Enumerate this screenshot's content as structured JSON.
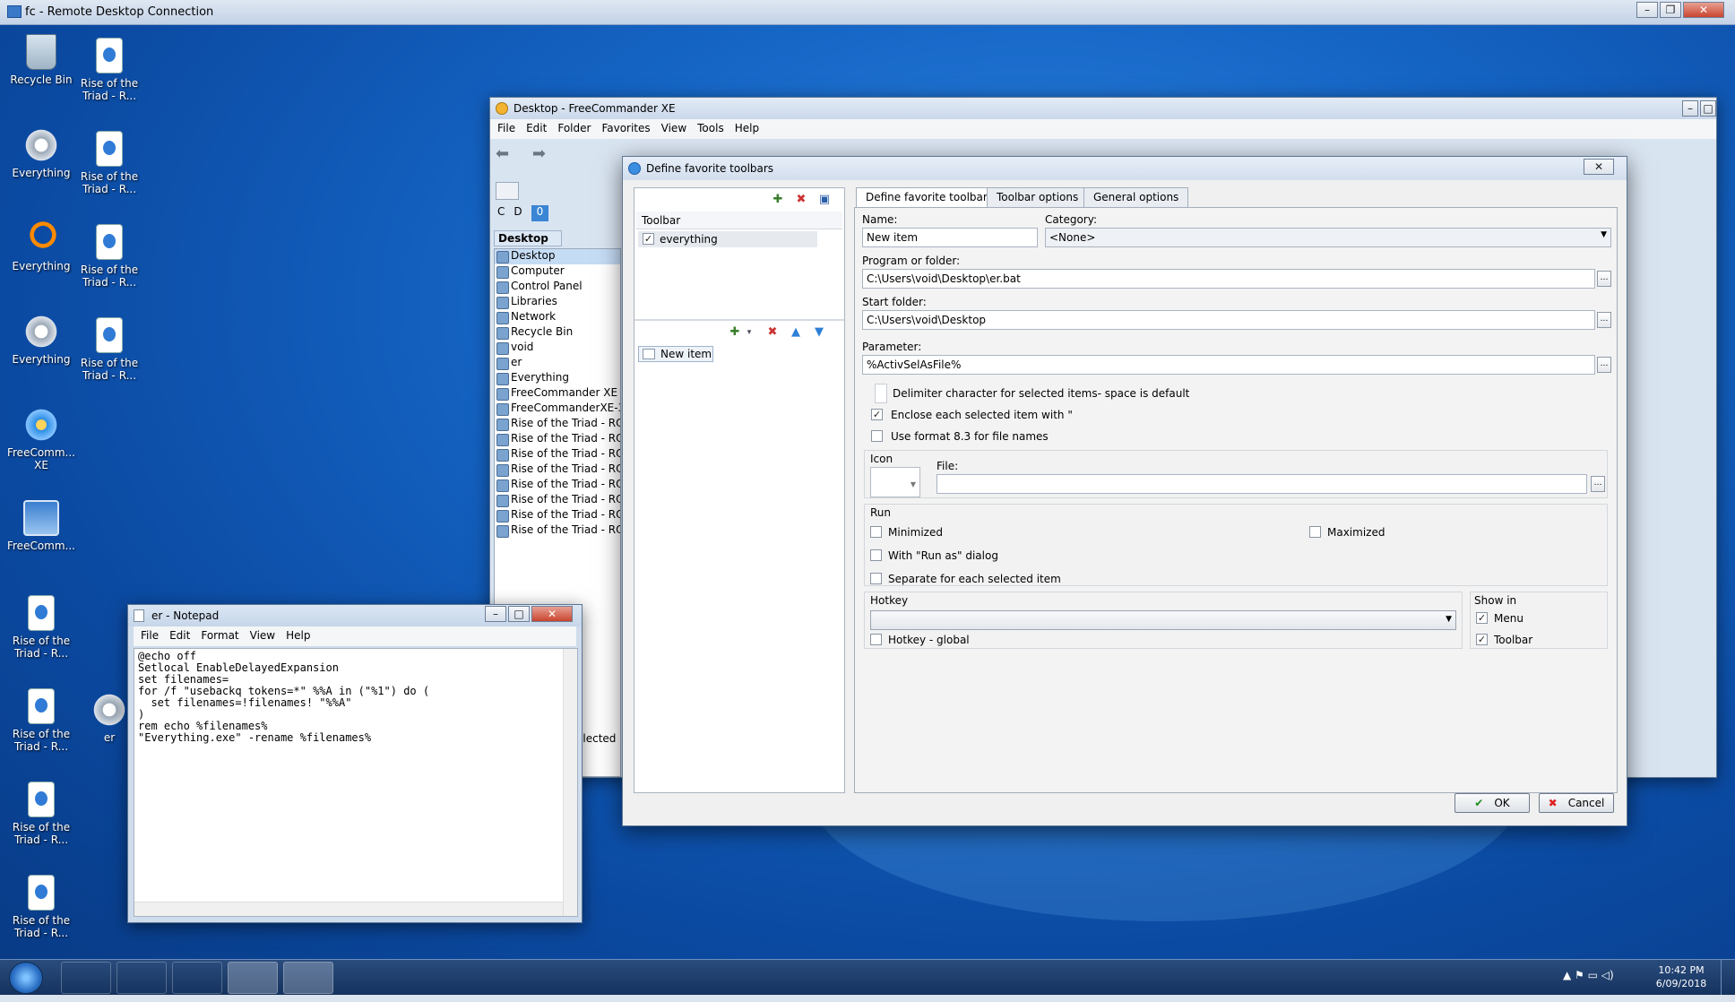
{
  "rdp": {
    "title": "fc - Remote Desktop Connection"
  },
  "desktop_icons": [
    {
      "label": "Recycle Bin"
    },
    {
      "label": "Rise of the Triad - R..."
    },
    {
      "label": "Everything"
    },
    {
      "label": "Rise of the Triad - R..."
    },
    {
      "label": "Everything"
    },
    {
      "label": "Rise of the Triad - R..."
    },
    {
      "label": "Everything"
    },
    {
      "label": "Rise of the Triad - R..."
    },
    {
      "label": "FreeComm... XE"
    },
    {
      "label": "FreeComm..."
    },
    {
      "label": "Rise of the Triad - R..."
    },
    {
      "label": "Rise of the Triad - R..."
    },
    {
      "label": "er"
    },
    {
      "label": "Rise of the Triad - R..."
    },
    {
      "label": "Rise of the Triad - R..."
    }
  ],
  "fc": {
    "title": "Desktop - FreeCommander XE",
    "menu": [
      "File",
      "Edit",
      "Folder",
      "Favorites",
      "View",
      "Tools",
      "Help"
    ],
    "drives": [
      "C",
      "D",
      "0"
    ],
    "tab_label": "Desktop",
    "tree_root": "Desktop",
    "tree": [
      "Computer",
      "Control Panel",
      "Libraries",
      "Network",
      "Recycle Bin",
      "void",
      "er",
      "Everything",
      "FreeCommander XE",
      "FreeCommanderXE-32",
      "Rise of the Triad - RO",
      "Rise of the Triad - RO",
      "Rise of the Triad - RO",
      "Rise of the Triad - RO",
      "Rise of the Triad - RO",
      "Rise of the Triad - RO",
      "Rise of the Triad - RO",
      "Rise of the Triad - RO"
    ],
    "status_fragment": "elected"
  },
  "dialog": {
    "title": "Define favorite toolbars",
    "toolbar_header": "Toolbar",
    "toolbar_item": "everything",
    "item_name": "New item",
    "tabs": [
      "Define favorite toolbars",
      "Toolbar options",
      "General options"
    ],
    "name_label": "Name:",
    "name_value": "New item",
    "category_label": "Category:",
    "category_value": "<None>",
    "program_label": "Program or folder:",
    "program_value": "C:\\Users\\void\\Desktop\\er.bat",
    "start_label": "Start folder:",
    "start_value": "C:\\Users\\void\\Desktop",
    "param_label": "Parameter:",
    "param_value": "%ActivSelAsFile%",
    "delimiter_label": "Delimiter character for selected items- space is default",
    "enclose_label": "Enclose each selected item with \"",
    "format83_label": "Use format 8.3 for file names",
    "icon_label": "Icon",
    "file_label": "File:",
    "run_label": "Run",
    "minimized_label": "Minimized",
    "maximized_label": "Maximized",
    "runas_label": "With \"Run as\" dialog",
    "separate_label": "Separate for each selected item",
    "hotkey_label": "Hotkey",
    "hotkey_global_label": "Hotkey - global",
    "showin_label": "Show in",
    "menu_label": "Menu",
    "toolbar_label": "Toolbar",
    "ok_label": "OK",
    "cancel_label": "Cancel",
    "checks": {
      "enclose": true,
      "menu": true,
      "toolbar": true,
      "everything": true
    }
  },
  "notepad": {
    "title": "er - Notepad",
    "menu": [
      "File",
      "Edit",
      "Format",
      "View",
      "Help"
    ],
    "lines": [
      "@echo off",
      "Setlocal EnableDelayedExpansion",
      "set filenames=",
      "for /f \"usebackq tokens=*\" %%A in (\"%1\") do (",
      "  set filenames=!filenames! \"%%A\"",
      ")",
      "rem echo %filenames%",
      "\"Everything.exe\" -rename %filenames%"
    ]
  },
  "taskbar": {
    "time": "10:42 PM",
    "date": "6/09/2018"
  }
}
